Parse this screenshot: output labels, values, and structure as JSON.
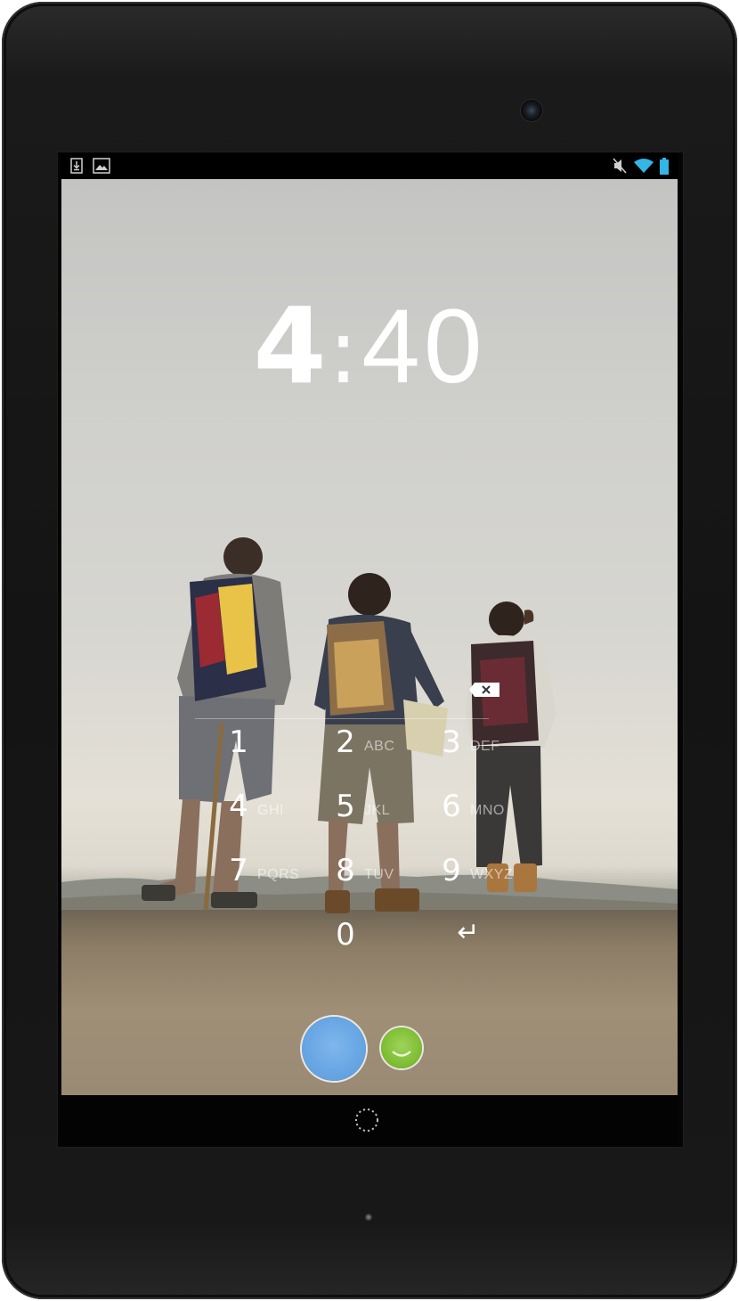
{
  "status_bar": {
    "left_icons": [
      "download-icon",
      "image-icon"
    ],
    "right_icons": [
      "mute-icon",
      "wifi-icon",
      "battery-icon"
    ],
    "colors": {
      "wifi": "#33b5e5",
      "battery": "#33b5e5"
    }
  },
  "lockscreen": {
    "clock": {
      "hours": "4",
      "separator": ":",
      "minutes": "40"
    },
    "pin_entry": {
      "delete_icon": "backspace-icon"
    },
    "keypad": [
      {
        "digit": "1",
        "letters": ""
      },
      {
        "digit": "2",
        "letters": "ABC"
      },
      {
        "digit": "3",
        "letters": "DEF"
      },
      {
        "digit": "4",
        "letters": "GHI"
      },
      {
        "digit": "5",
        "letters": "JKL"
      },
      {
        "digit": "6",
        "letters": "MNO"
      },
      {
        "digit": "7",
        "letters": "PQRS"
      },
      {
        "digit": "8",
        "letters": "TUV"
      },
      {
        "digit": "9",
        "letters": "WXYZ"
      },
      {
        "digit": "0",
        "letters": ""
      },
      {
        "digit": "↵",
        "letters": ""
      }
    ],
    "contacts": {
      "colors": {
        "blue": "#68a6e4",
        "green": "#7fbf35"
      }
    }
  },
  "nav_bar": {
    "home_icon": "home-icon"
  }
}
